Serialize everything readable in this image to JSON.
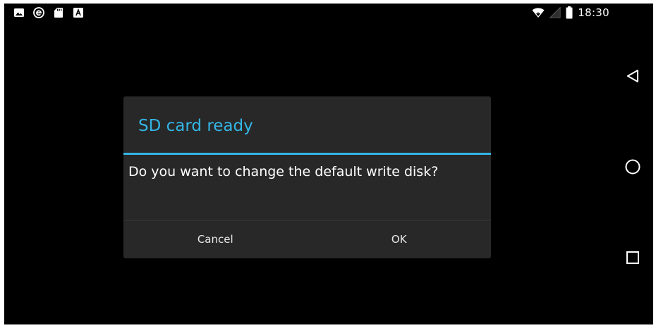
{
  "status_bar": {
    "notification_icons": [
      "image-icon",
      "e-icon",
      "sd-card-icon",
      "keyboard-a-icon"
    ],
    "status_icons": [
      "wifi-icon",
      "signal-icon",
      "battery-icon"
    ],
    "time": "18:30"
  },
  "nav_bar": {
    "buttons": [
      "back-icon",
      "home-icon",
      "recents-icon"
    ]
  },
  "dialog": {
    "title": "SD card ready",
    "message": "Do you want to change the default write disk?",
    "cancel_label": "Cancel",
    "ok_label": "OK"
  },
  "colors": {
    "accent": "#33b5e5",
    "dialog_background": "#282828",
    "screen_background": "#000000"
  }
}
